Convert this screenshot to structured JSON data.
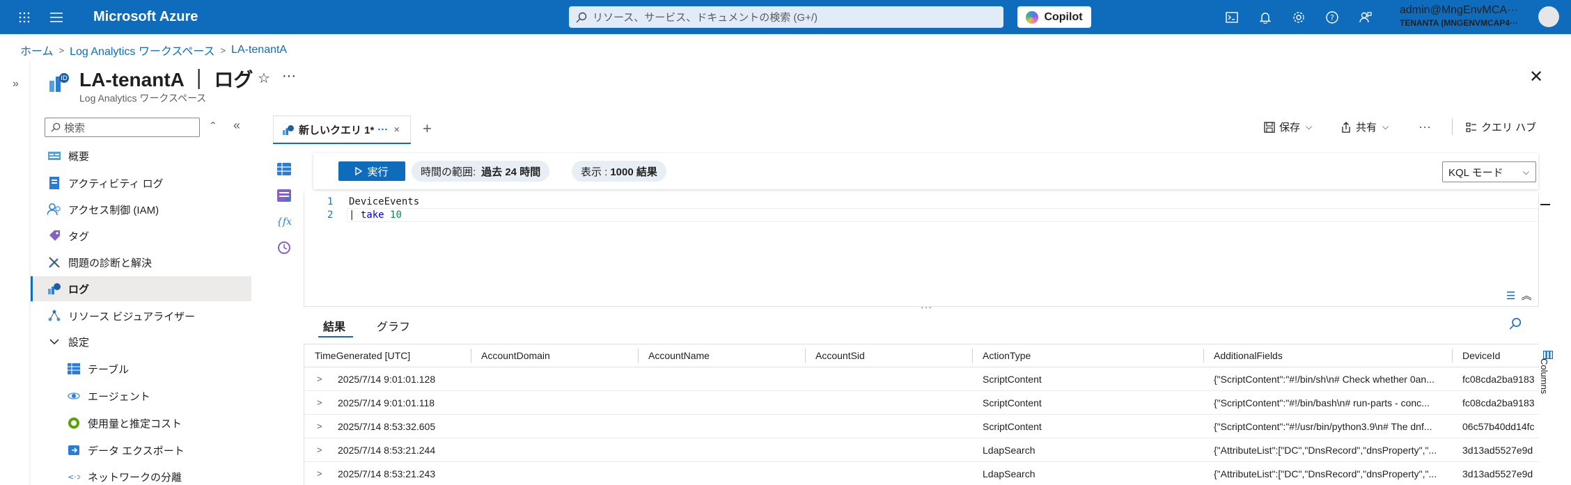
{
  "topbar": {
    "brand": "Microsoft Azure",
    "search_placeholder": "リソース、サービス、ドキュメントの検索 (G+/)",
    "copilot_label": "Copilot",
    "account_name": "admin@MngEnvMCA···",
    "account_tenant": "TENANTA (MNGENVMCAP4···"
  },
  "breadcrumb": {
    "items": [
      "ホーム",
      "Log Analytics ワークスペース",
      "LA-tenantA"
    ]
  },
  "header": {
    "title": "LA-tenantA ｜ ログ",
    "subtitle": "Log Analytics ワークスペース"
  },
  "nav": {
    "search_placeholder": "検索",
    "items": [
      {
        "label": "概要"
      },
      {
        "label": "アクティビティ ログ"
      },
      {
        "label": "アクセス制御 (IAM)"
      },
      {
        "label": "タグ"
      },
      {
        "label": "問題の診断と解決"
      },
      {
        "label": "ログ"
      },
      {
        "label": "リソース ビジュアライザー"
      },
      {
        "label": "設定"
      },
      {
        "label": "テーブル"
      },
      {
        "label": "エージェント"
      },
      {
        "label": "使用量と推定コスト"
      },
      {
        "label": "データ エクスポート"
      },
      {
        "label": "ネットワークの分離"
      }
    ]
  },
  "query_tab": {
    "label": "新しいクエリ 1*",
    "dots": "···",
    "close": "×"
  },
  "commands": {
    "save": "保存",
    "share": "共有",
    "more": "···",
    "query_hub": "クエリ ハブ"
  },
  "toolbar": {
    "run": "実行",
    "time_range_label": "時間の範囲:",
    "time_range_value": "過去 24 時間",
    "show_label": "表示 :",
    "show_value": "1000 結果",
    "mode": "KQL モード"
  },
  "editor": {
    "line_numbers": [
      "1",
      "2"
    ],
    "line1": "DeviceEvents",
    "line2_pipe": "| ",
    "line2_kw": "take",
    "line2_num": "10"
  },
  "results": {
    "tabs": [
      "結果",
      "グラフ"
    ],
    "columns": [
      "TimeGenerated [UTC]",
      "AccountDomain",
      "AccountName",
      "AccountSid",
      "ActionType",
      "AdditionalFields",
      "DeviceId"
    ],
    "columns_panel": "Columns",
    "rows": [
      [
        "2025/7/14 9:01:01.128",
        "",
        "",
        "",
        "ScriptContent",
        "{\"ScriptContent\":\"#!/bin/sh\\n# Check whether 0an...",
        "fc08cda2ba9183"
      ],
      [
        "2025/7/14 9:01:01.118",
        "",
        "",
        "",
        "ScriptContent",
        "{\"ScriptContent\":\"#!/bin/bash\\n# run-parts - conc...",
        "fc08cda2ba9183"
      ],
      [
        "2025/7/14 8:53:32.605",
        "",
        "",
        "",
        "ScriptContent",
        "{\"ScriptContent\":\"#!/usr/bin/python3.9\\n# The dnf...",
        "06c57b40dd14fc"
      ],
      [
        "2025/7/14 8:53:21.244",
        "",
        "",
        "",
        "LdapSearch",
        "{\"AttributeList\":[\"DC\",\"DnsRecord\",\"dnsProperty\",\"...",
        "3d13ad5527e9d"
      ],
      [
        "2025/7/14 8:53:21.243",
        "",
        "",
        "",
        "LdapSearch",
        "{\"AttributeList\":[\"DC\",\"DnsRecord\",\"dnsProperty\",\"...",
        "3d13ad5527e9d"
      ]
    ]
  }
}
